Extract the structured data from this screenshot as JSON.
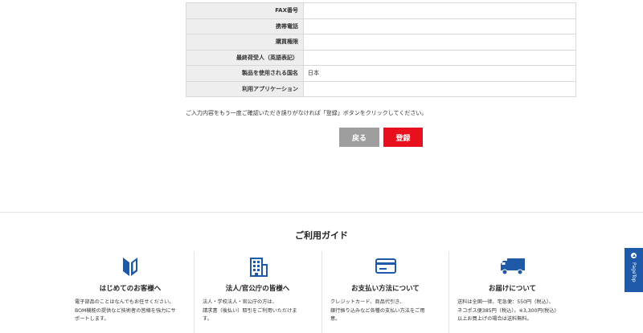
{
  "form_rows": [
    {
      "label": "FAX番号",
      "value": ""
    },
    {
      "label": "携帯電話",
      "value": ""
    },
    {
      "label": "購買権限",
      "value": ""
    },
    {
      "label": "最終荷受人（英語表記）",
      "value": ""
    },
    {
      "label": "製品を使用される国名",
      "value": "日本"
    },
    {
      "label": "利用アプリケーション",
      "value": ""
    }
  ],
  "notice": "ご入力内容をもう一度ご確認いただき誤りがなければ「登録」ボタンをクリックしてください。",
  "buttons": {
    "back": "戻る",
    "register": "登録"
  },
  "guide": {
    "title": "ご利用ガイド",
    "columns": [
      {
        "icon": "beginner-mark-icon",
        "title": "はじめてのお客様へ",
        "desc": [
          "電子部品のことはなんでもお任せください。",
          "BOM機能の提供など技術者の皆様を強力にサ",
          "ポートします。"
        ]
      },
      {
        "icon": "building-icon",
        "title": "法人/官公庁の皆様へ",
        "desc": [
          "法人・学校法人・官公庁の方は、",
          "請求書（後払い）取引をご利用いただけま",
          "す。"
        ]
      },
      {
        "icon": "credit-card-icon",
        "title": "お支払い方法について",
        "desc": [
          "クレジットカード、商品代引き、",
          "銀行振り込みなど各種の支払い方法をご用",
          "意。"
        ]
      },
      {
        "icon": "delivery-truck-icon",
        "title": "お届けについて",
        "desc": [
          "送料は全国一律、宅急便：550円（税込）、",
          "ネコポス便385円（税込）。※3,300円(税込)",
          "以上お買上げの場合は送料無料。"
        ]
      }
    ]
  },
  "pagetop": {
    "label": "PageTop"
  },
  "colors": {
    "accent_red": "#e8101c",
    "brand_blue": "#1e5aa8",
    "button_gray": "#9e9e9e"
  }
}
